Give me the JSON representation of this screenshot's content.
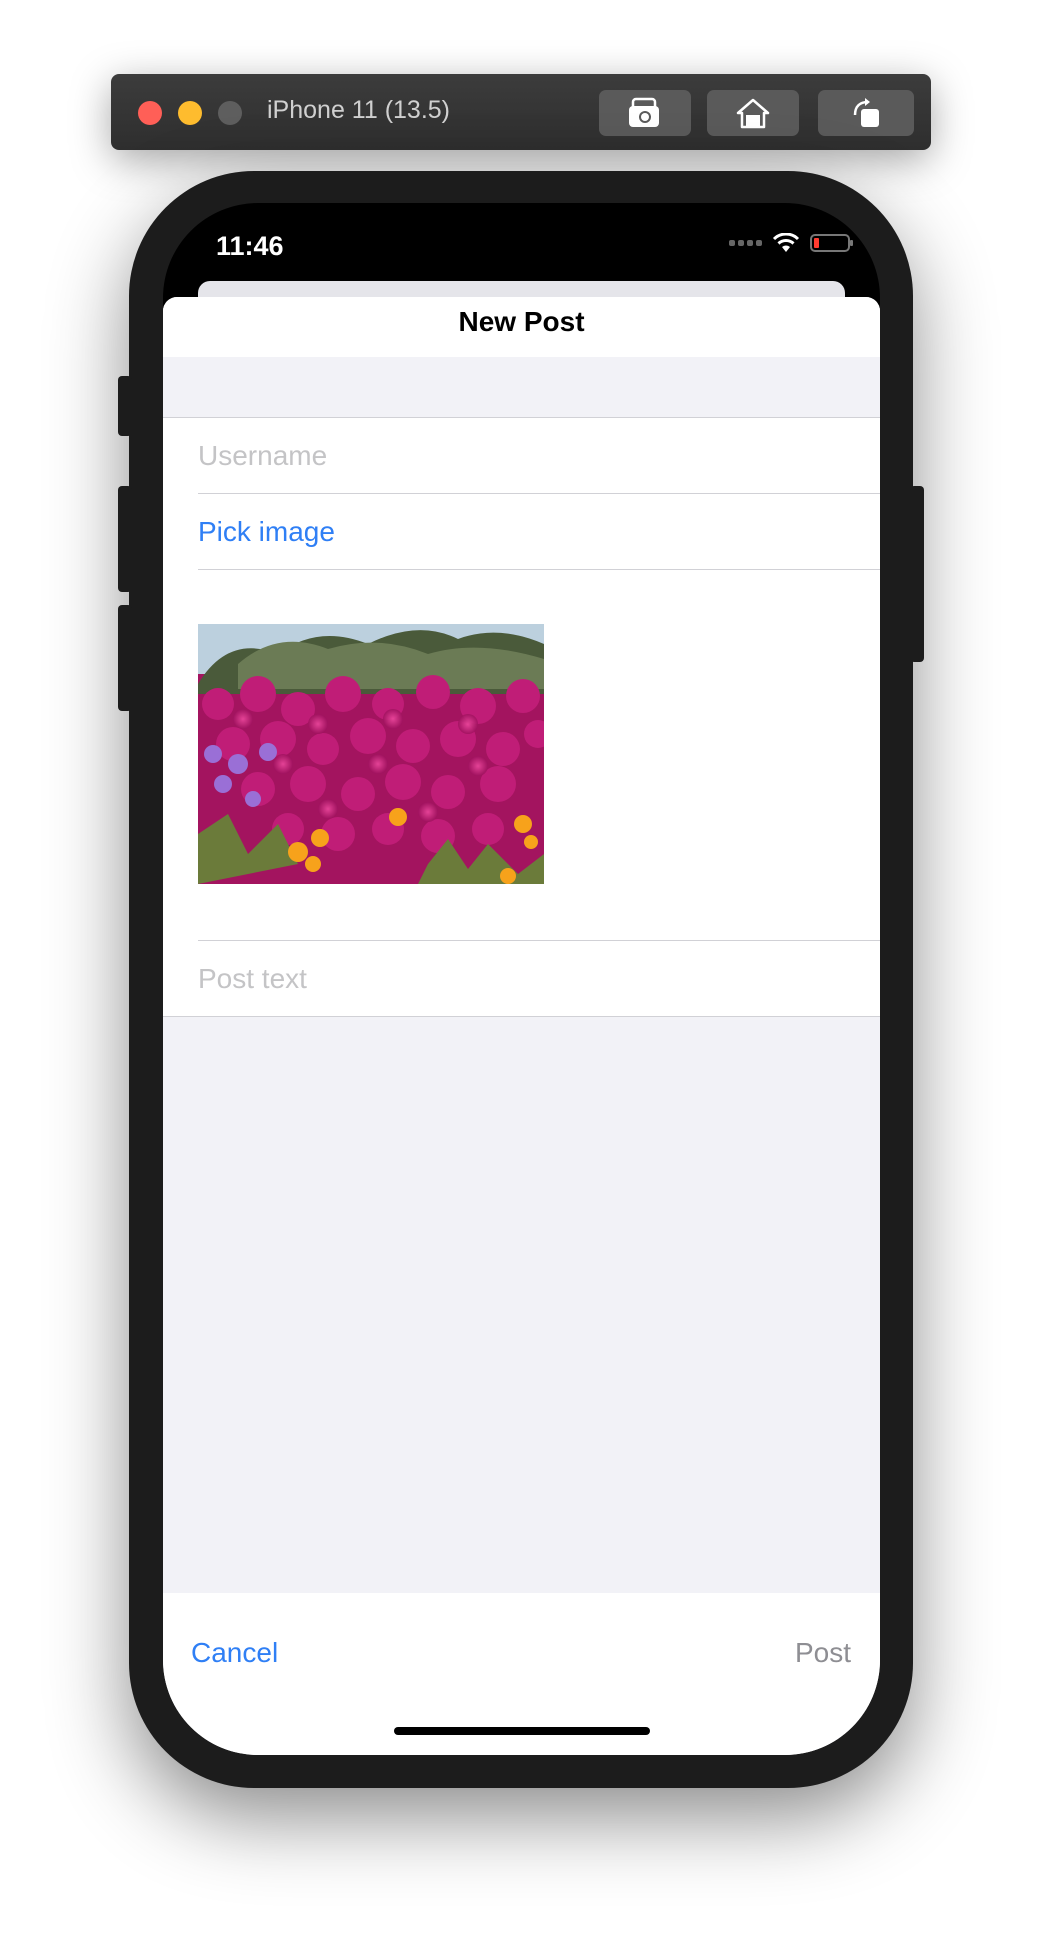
{
  "simulator": {
    "title": "iPhone 11 (13.5)",
    "buttons": [
      "screenshot-icon",
      "home-icon",
      "rotate-icon"
    ]
  },
  "status_bar": {
    "time": "11:46",
    "battery_level": "low"
  },
  "nav": {
    "title": "New Post"
  },
  "form": {
    "username_placeholder": "Username",
    "pick_image_label": "Pick image",
    "image_description_icon": "flower-photo",
    "post_text_placeholder": "Post text"
  },
  "toolbar": {
    "cancel_label": "Cancel",
    "post_label": "Post"
  },
  "colors": {
    "accent": "#2f7ff5",
    "disabled": "#8e8e93",
    "grouped_background": "#f2f2f7"
  }
}
